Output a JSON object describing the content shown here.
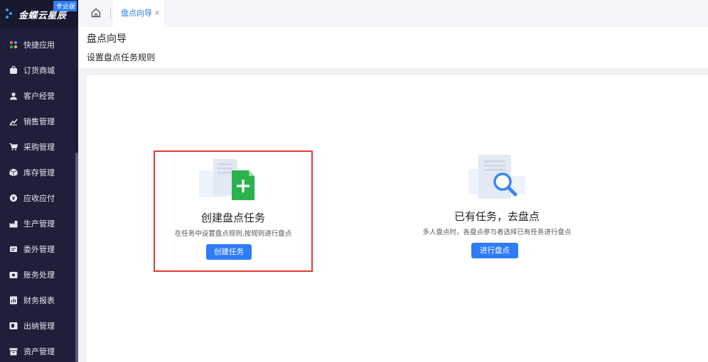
{
  "app": {
    "logo_text": "金蝶云星辰",
    "logo_badge": "专业版"
  },
  "sidebar": {
    "items": [
      {
        "label": "快捷应用",
        "icon": "grid-apps-icon"
      },
      {
        "label": "订货商城",
        "icon": "shopping-bag-icon"
      },
      {
        "label": "客户经营",
        "icon": "customer-icon"
      },
      {
        "label": "销售管理",
        "icon": "sales-chart-icon"
      },
      {
        "label": "采购管理",
        "icon": "cart-icon"
      },
      {
        "label": "库存管理",
        "icon": "box-icon"
      },
      {
        "label": "应收应付",
        "icon": "receivable-icon"
      },
      {
        "label": "生产管理",
        "icon": "factory-icon"
      },
      {
        "label": "委外管理",
        "icon": "outsource-icon"
      },
      {
        "label": "账务处理",
        "icon": "ledger-icon"
      },
      {
        "label": "财务报表",
        "icon": "report-icon"
      },
      {
        "label": "出纳管理",
        "icon": "cashier-icon"
      },
      {
        "label": "资产管理",
        "icon": "asset-icon"
      }
    ]
  },
  "tabs": {
    "home_icon": "home-icon",
    "active_label": "盘点向导",
    "close_glyph": "×"
  },
  "header": {
    "title": "盘点向导",
    "subtitle": "设置盘点任务规则"
  },
  "cards": [
    {
      "title": "创建盘点任务",
      "desc": "在任务中设置盘点规则,按规则进行盘点",
      "button": "创建任务",
      "icon": "add-document-icon"
    },
    {
      "title": "已有任务，去盘点",
      "desc": "多人盘点时，各盘点参与者选择已有任务进行盘点",
      "button": "进行盘点",
      "icon": "search-document-icon"
    }
  ],
  "colors": {
    "sidebar_bg": "#1d1f3b",
    "accent": "#2f7cf6",
    "highlight_border": "#e53935",
    "doc_green": "#2bb24c"
  }
}
